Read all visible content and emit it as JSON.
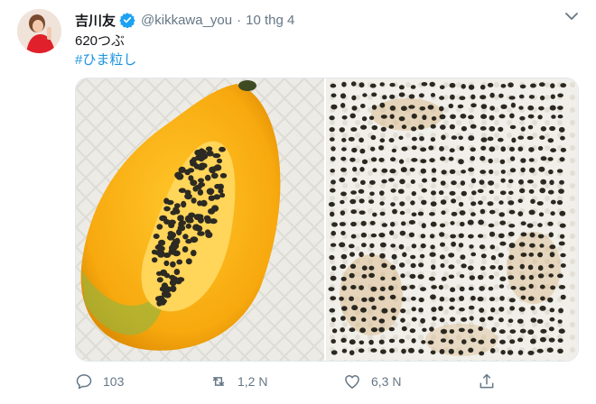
{
  "tweet": {
    "display_name": "吉川友",
    "handle": "@kikkawa_you",
    "separator": "·",
    "date": "10 thg 4",
    "text": "620つぶ",
    "hashtag": "#ひま粒し"
  },
  "actions": {
    "reply_count": "103",
    "retweet_count": "1,2 N",
    "like_count": "6,3 N"
  },
  "colors": {
    "link": "#1b95e0",
    "secondary_text": "#657786",
    "verified": "#1da1f2"
  },
  "icons": [
    "avatar",
    "verified-badge-icon",
    "chevron-down-icon",
    "reply-icon",
    "retweet-icon",
    "like-icon",
    "share-icon"
  ]
}
